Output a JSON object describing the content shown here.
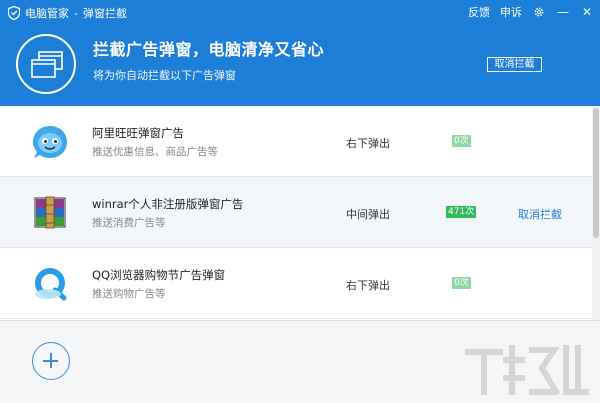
{
  "titlebar": {
    "app_name": "电脑管家",
    "separator": "-",
    "module": "弹窗拦截",
    "feedback": "反馈",
    "appeal": "申诉",
    "settings_icon": "gear-icon",
    "minimize_glyph": "—",
    "close_glyph": "✕"
  },
  "banner": {
    "headline": "拦截广告弹窗，电脑清净又省心",
    "subtitle": "将为你自动拦截以下广告弹窗",
    "cancel_button": "取消拦截"
  },
  "rows": [
    {
      "title": "阿里旺旺弹窗广告",
      "desc": "推送优惠信息、商品广告等",
      "position": "右下弹出",
      "count": "0次",
      "action": "",
      "icon": "aliwangwang-icon"
    },
    {
      "title": "winrar个人非注册版弹窗广告",
      "desc": "推送消费广告等",
      "position": "中间弹出",
      "count": "471次",
      "action": "取消拦截",
      "icon": "winrar-icon"
    },
    {
      "title": "QQ浏览器购物节广告弹窗",
      "desc": "推送购物广告等",
      "position": "右下弹出",
      "count": "0次",
      "action": "",
      "icon": "qq-browser-icon"
    }
  ],
  "footer": {
    "add_icon": "plus-icon"
  },
  "colors": {
    "brand_blue": "#1d7ed8",
    "count_green": "#2fbd5a",
    "count_light_green": "#8fd8a8"
  }
}
